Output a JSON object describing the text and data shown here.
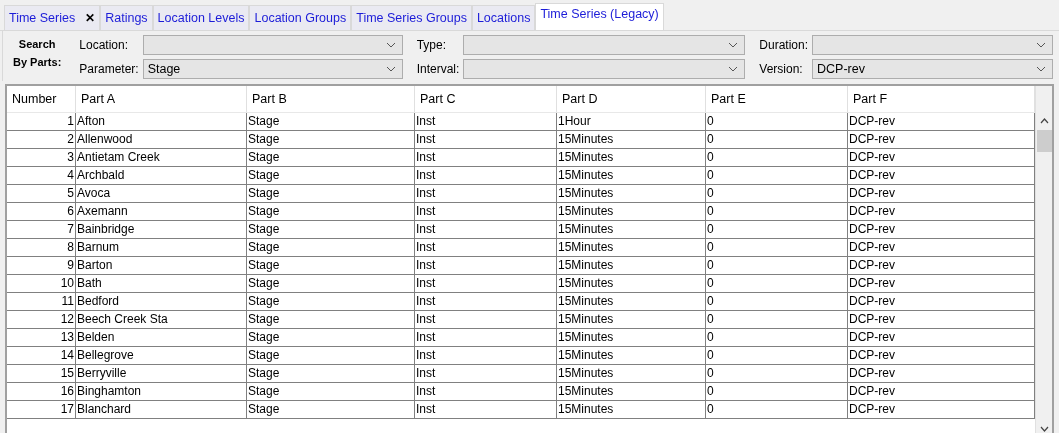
{
  "tabs": [
    {
      "label": "Time Series",
      "closable": true,
      "selected": false
    },
    {
      "label": "Ratings",
      "closable": false,
      "selected": false
    },
    {
      "label": "Location Levels",
      "closable": false,
      "selected": false
    },
    {
      "label": "Location Groups",
      "closable": false,
      "selected": false
    },
    {
      "label": "Time Series Groups",
      "closable": false,
      "selected": false
    },
    {
      "label": "Locations",
      "closable": false,
      "selected": false
    },
    {
      "label": "Time Series (Legacy)",
      "closable": false,
      "selected": true
    }
  ],
  "close_glyph": "✕",
  "search": {
    "title_line_1": "Search",
    "title_line_2": "By Parts:",
    "fields": [
      {
        "label": "Location:"
      },
      {
        "label": "Type:"
      },
      {
        "label": "Duration:"
      },
      {
        "label": "Parameter:",
        "value": "Stage"
      },
      {
        "label": "Interval:"
      },
      {
        "label": "Version:",
        "value": "DCP-rev"
      }
    ]
  },
  "table": {
    "columns": [
      "Number",
      "Part A",
      "Part B",
      "Part C",
      "Part D",
      "Part E",
      "Part F"
    ],
    "rows": [
      [
        "1",
        "Afton",
        "Stage",
        "Inst",
        "1Hour",
        "0",
        "DCP-rev"
      ],
      [
        "2",
        "Allenwood",
        "Stage",
        "Inst",
        "15Minutes",
        "0",
        "DCP-rev"
      ],
      [
        "3",
        "Antietam Creek",
        "Stage",
        "Inst",
        "15Minutes",
        "0",
        "DCP-rev"
      ],
      [
        "4",
        "Archbald",
        "Stage",
        "Inst",
        "15Minutes",
        "0",
        "DCP-rev"
      ],
      [
        "5",
        "Avoca",
        "Stage",
        "Inst",
        "15Minutes",
        "0",
        "DCP-rev"
      ],
      [
        "6",
        "Axemann",
        "Stage",
        "Inst",
        "15Minutes",
        "0",
        "DCP-rev"
      ],
      [
        "7",
        "Bainbridge",
        "Stage",
        "Inst",
        "15Minutes",
        "0",
        "DCP-rev"
      ],
      [
        "8",
        "Barnum",
        "Stage",
        "Inst",
        "15Minutes",
        "0",
        "DCP-rev"
      ],
      [
        "9",
        "Barton",
        "Stage",
        "Inst",
        "15Minutes",
        "0",
        "DCP-rev"
      ],
      [
        "10",
        "Bath",
        "Stage",
        "Inst",
        "15Minutes",
        "0",
        "DCP-rev"
      ],
      [
        "11",
        "Bedford",
        "Stage",
        "Inst",
        "15Minutes",
        "0",
        "DCP-rev"
      ],
      [
        "12",
        "Beech Creek Sta",
        "Stage",
        "Inst",
        "15Minutes",
        "0",
        "DCP-rev"
      ],
      [
        "13",
        "Belden",
        "Stage",
        "Inst",
        "15Minutes",
        "0",
        "DCP-rev"
      ],
      [
        "14",
        "Bellegrove",
        "Stage",
        "Inst",
        "15Minutes",
        "0",
        "DCP-rev"
      ],
      [
        "15",
        "Berryville",
        "Stage",
        "Inst",
        "15Minutes",
        "0",
        "DCP-rev"
      ],
      [
        "16",
        "Binghamton",
        "Stage",
        "Inst",
        "15Minutes",
        "0",
        "DCP-rev"
      ],
      [
        "17",
        "Blanchard",
        "Stage",
        "Inst",
        "15Minutes",
        "0",
        "DCP-rev"
      ]
    ]
  }
}
